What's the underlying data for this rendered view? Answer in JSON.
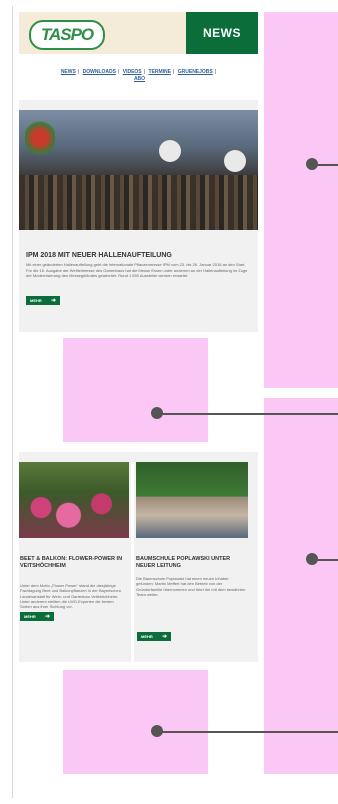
{
  "header": {
    "logo_text": "TASPO",
    "news_label": "NEWS"
  },
  "nav": {
    "links": [
      "NEWS",
      "DOWNLOADS",
      "VIDEOS",
      "TERMINE",
      "GRUENEJOBS",
      "ABO"
    ]
  },
  "main_article": {
    "title": "IPM 2018 MIT NEUER HALLENAUFTEILUNG",
    "body": "Mit einer geänderten Hallenaufteilung geht die Internationale Pflanzenmesse IPM vom 23. bis 26. Januar 2018 an den Start. Für die 16. Ausgabe der Weltleitmesse des Gartenbaus hat die Messe Essen unter anderem an der Hallenaufteilung im Zuge der Modernisierung des Messegeländes gearbeitet. Rund 1.550 Aussteller werden erwartet.",
    "more_label": "MEHR"
  },
  "articles": [
    {
      "title": "BEET & BALKON: FLOWER-POWER IN VEITSHÖCHHEIM",
      "body": "Unter dem Motto „Flower Power“ stand die diesjährige Fachtagung Beet und Balkonpflanzen in der Bayerischen Landesanstalt für Wein- und Gartenbau Veitshöchheim. Unter anderem stellten die LWG-Experten die besten Sorten aus ihrer Sichtung vor.",
      "more_label": "MEHR"
    },
    {
      "title": "BAUMSCHULE POPLAWSKI UNTER NEUER LEITUNG",
      "body": "Die Baumschule Poplawski hat einen neuen Inhaber gefunden: Martin Meffert hat den Betrieb von der Gründerfamilie übernommen und führt ihn mit dem bewährten Team weiter.",
      "more_label": "MEHR"
    }
  ]
}
